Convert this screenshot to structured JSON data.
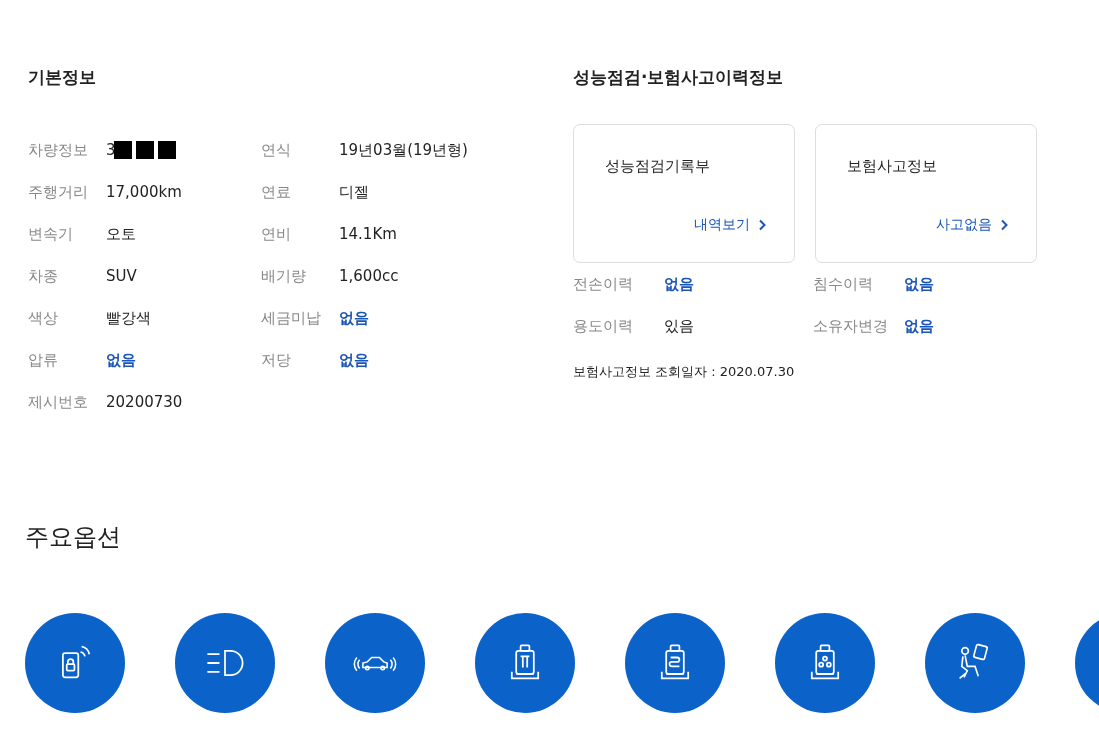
{
  "basic_info": {
    "title": "기본정보",
    "rows": [
      [
        {
          "label": "차량정보",
          "value": "3",
          "redacted": true,
          "link": false
        },
        {
          "label": "연식",
          "value": "19년03월(19년형)",
          "redacted": false,
          "link": false
        }
      ],
      [
        {
          "label": "주행거리",
          "value": "17,000km",
          "redacted": false,
          "link": false
        },
        {
          "label": "연료",
          "value": "디젤",
          "redacted": false,
          "link": false
        }
      ],
      [
        {
          "label": "변속기",
          "value": "오토",
          "redacted": false,
          "link": false
        },
        {
          "label": "연비",
          "value": "14.1Km",
          "redacted": false,
          "link": false
        }
      ],
      [
        {
          "label": "차종",
          "value": "SUV",
          "redacted": false,
          "link": false
        },
        {
          "label": "배기량",
          "value": "1,600cc",
          "redacted": false,
          "link": false
        }
      ],
      [
        {
          "label": "색상",
          "value": "빨강색",
          "redacted": false,
          "link": false
        },
        {
          "label": "세금미납",
          "value": "없음",
          "redacted": false,
          "link": true
        }
      ],
      [
        {
          "label": "압류",
          "value": "없음",
          "redacted": false,
          "link": true
        },
        {
          "label": "저당",
          "value": "없음",
          "redacted": false,
          "link": true
        }
      ],
      [
        {
          "label": "제시번호",
          "value": "20200730",
          "redacted": false,
          "link": false
        }
      ]
    ]
  },
  "history": {
    "title": "성능점검·보험사고이력정보",
    "cards": [
      {
        "title": "성능점검기록부",
        "link": "내역보기"
      },
      {
        "title": "보험사고정보",
        "link": "사고없음"
      }
    ],
    "rows": [
      [
        {
          "label": "전손이력",
          "value": "없음",
          "link": true
        },
        {
          "label": "침수이력",
          "value": "없음",
          "link": true
        }
      ],
      [
        {
          "label": "용도이력",
          "value": "있음",
          "link": false
        },
        {
          "label": "소유자변경",
          "value": "없음",
          "link": true
        }
      ]
    ],
    "note": "보험사고정보 조회일자 : 2020.07.30"
  },
  "options": {
    "title": "주요옵션",
    "items": [
      {
        "kind": "smartkey"
      },
      {
        "kind": "headlamp"
      },
      {
        "kind": "sensor"
      },
      {
        "kind": "ventseat"
      },
      {
        "kind": "heatseat"
      },
      {
        "kind": "memoryseat"
      },
      {
        "kind": "airbag"
      },
      {
        "kind": "partial"
      }
    ]
  }
}
